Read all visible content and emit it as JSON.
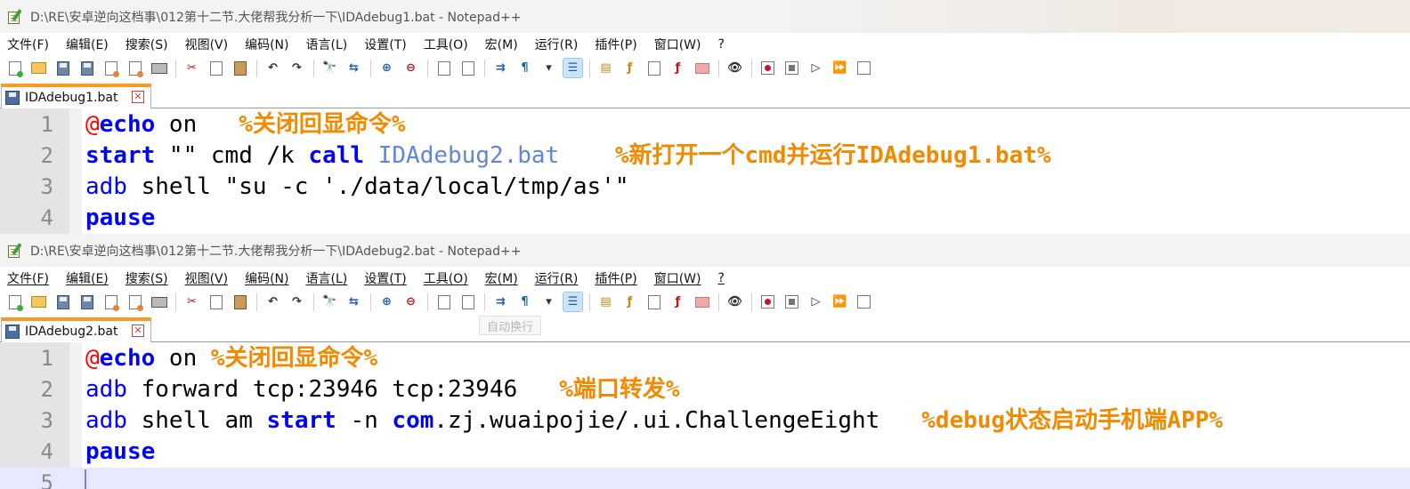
{
  "windows": [
    {
      "title": "D:\\RE\\安卓逆向这档事\\012第十二节.大佬帮我分析一下\\IDAdebug1.bat - Notepad++",
      "tab": "IDAdebug1.bat",
      "lines": [
        {
          "num": "1",
          "tokens": [
            [
              "at",
              "@"
            ],
            [
              "kw",
              "echo"
            ],
            [
              "arg",
              " on   "
            ],
            [
              "cm",
              "%关闭回显命令%"
            ]
          ]
        },
        {
          "num": "2",
          "tokens": [
            [
              "kw",
              "start"
            ],
            [
              "arg",
              " \"\" cmd /k "
            ],
            [
              "kw",
              "call"
            ],
            [
              "arg",
              " "
            ],
            [
              "lbl",
              "IDAdebug2.bat"
            ],
            [
              "arg",
              "    "
            ],
            [
              "cm",
              "%新打开一个cmd并运行IDAdebug1.bat%"
            ]
          ]
        },
        {
          "num": "3",
          "tokens": [
            [
              "kw2",
              "adb"
            ],
            [
              "arg",
              " shell \"su -c './data/local/tmp/as'\""
            ]
          ]
        },
        {
          "num": "4",
          "tokens": [
            [
              "kw",
              "pause"
            ]
          ]
        }
      ]
    },
    {
      "title": "D:\\RE\\安卓逆向这档事\\012第十二节.大佬帮我分析一下\\IDAdebug2.bat - Notepad++",
      "tab": "IDAdebug2.bat",
      "lines": [
        {
          "num": "1",
          "tokens": [
            [
              "at",
              "@"
            ],
            [
              "kw",
              "echo"
            ],
            [
              "arg",
              " on "
            ],
            [
              "cm",
              "%关闭回显命令%"
            ]
          ]
        },
        {
          "num": "2",
          "tokens": [
            [
              "kw2",
              "adb"
            ],
            [
              "arg",
              " forward tcp:23946 tcp:23946   "
            ],
            [
              "cm",
              "%端口转发%"
            ]
          ]
        },
        {
          "num": "3",
          "tokens": [
            [
              "kw2",
              "adb"
            ],
            [
              "arg",
              " shell am "
            ],
            [
              "kw",
              "start"
            ],
            [
              "arg",
              " -n "
            ],
            [
              "kw",
              "com"
            ],
            [
              "arg",
              ".zj.wuaipojie/.ui.ChallengeEight   "
            ],
            [
              "cm",
              "%debug状态启动手机端APP%"
            ]
          ]
        },
        {
          "num": "4",
          "tokens": [
            [
              "kw",
              "pause"
            ]
          ]
        },
        {
          "num": "5",
          "tokens": [],
          "current": true
        }
      ]
    }
  ],
  "menu": [
    "文件(F)",
    "编辑(E)",
    "搜索(S)",
    "视图(V)",
    "编码(N)",
    "语言(L)",
    "设置(T)",
    "工具(O)",
    "宏(M)",
    "运行(R)",
    "插件(P)",
    "窗口(W)",
    "?"
  ],
  "tooltip": "自动换行",
  "toolbar_icons": [
    "new-file-icon",
    "open-folder-icon",
    "save-icon",
    "save-all-icon",
    "close-icon",
    "close-all-icon",
    "print-icon",
    "sep",
    "cut-icon",
    "copy-icon",
    "paste-icon",
    "sep",
    "undo-icon",
    "redo-icon",
    "sep",
    "find-icon",
    "replace-icon",
    "sep",
    "zoom-in-icon",
    "zoom-out-icon",
    "sep",
    "sync-vertical-icon",
    "sync-horizontal-icon",
    "sep",
    "word-wrap-icon",
    "show-all-chars-icon",
    "dropdown-arrow-icon",
    "indent-guide-icon",
    "sep",
    "document-map-icon",
    "function-list-icon",
    "document-list-icon",
    "folder-workspace-icon",
    "monitoring-icon",
    "sep",
    "spy-icon",
    "sep",
    "record-macro-icon",
    "stop-macro-icon",
    "play-macro-icon",
    "run-macro-multiple-icon",
    "save-macro-icon"
  ],
  "colors": {
    "keyword": "#0000ff",
    "at_sign": "#ff0000",
    "comment": "#f28a00",
    "label": "#5f87d9",
    "tab_accent": "#fa9a1e"
  }
}
